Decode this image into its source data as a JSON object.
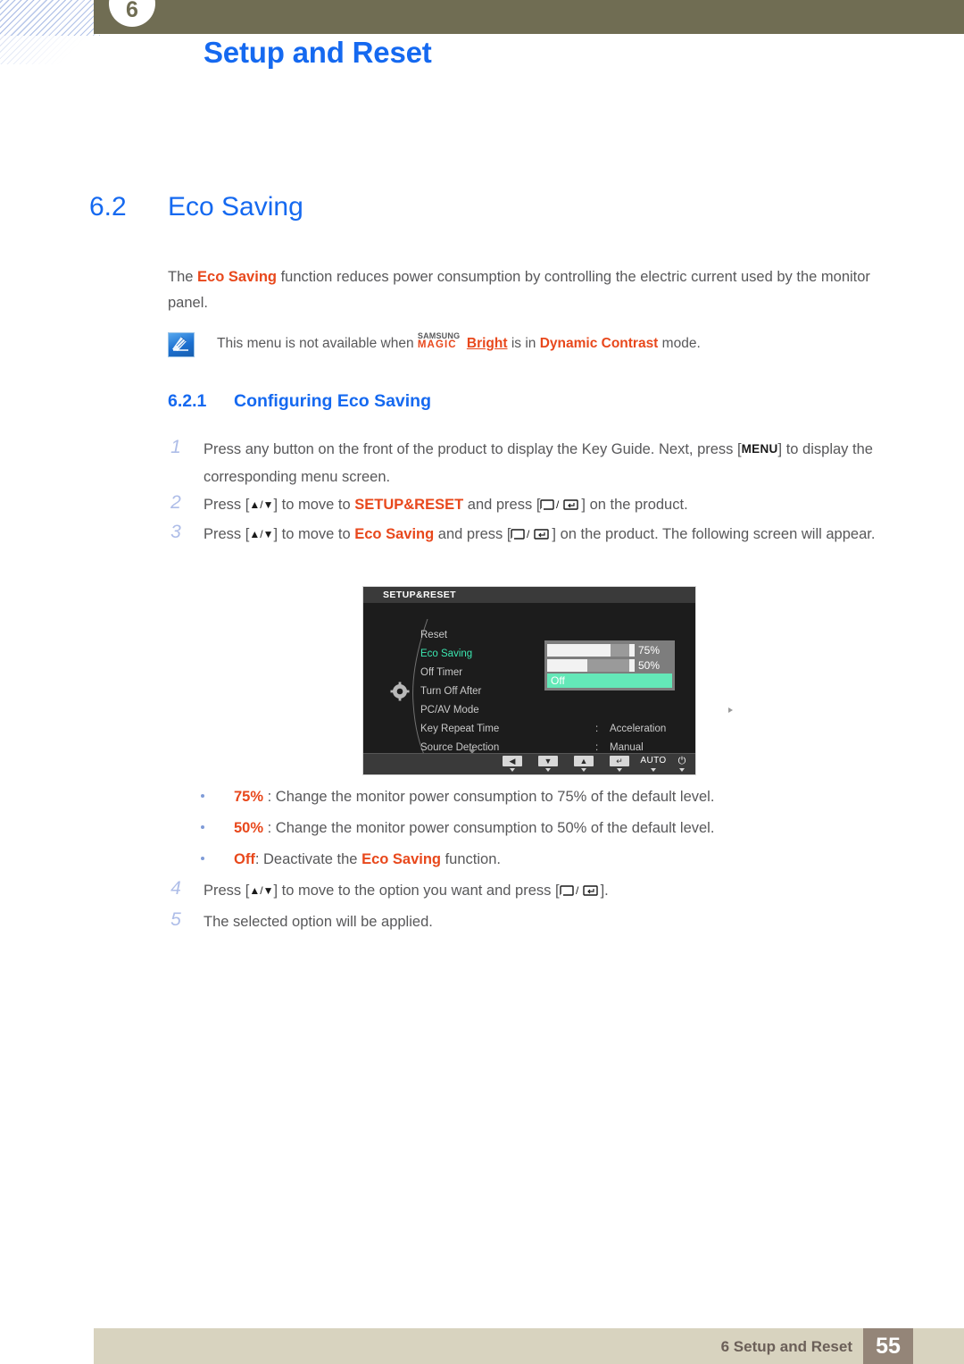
{
  "header": {
    "chapter_number": "6",
    "title": "Setup and Reset"
  },
  "section": {
    "number": "6.2",
    "title": "Eco Saving"
  },
  "intro": {
    "part1": "The ",
    "highlight": "Eco Saving",
    "part2": " function reduces power consumption by controlling the electric current used by the monitor panel."
  },
  "note": {
    "icon": "note-pencil-icon",
    "text_before": "This menu is not available when ",
    "magic_samsung": "SAMSUNG",
    "magic_word": "MAGIC",
    "magic_bright": "Bright",
    "text_middle": " is in ",
    "mode": "Dynamic Contrast",
    "text_after": " mode."
  },
  "subsection": {
    "number": "6.2.1",
    "title": "Configuring Eco Saving"
  },
  "steps": [
    {
      "num": "1",
      "text_a": "Press any button on the front of the product to display the Key Guide. Next, press [",
      "key": "MENU",
      "text_b": "] to display the corresponding menu screen."
    },
    {
      "num": "2",
      "text_a": "Press [",
      "arrows": "▲/▼",
      "text_b": "] to move to ",
      "target": "SETUP&RESET",
      "text_c": " and press [",
      "text_d": "] on the product."
    },
    {
      "num": "3",
      "text_a": "Press [",
      "arrows": "▲/▼",
      "text_b": "] to move to ",
      "target": "Eco Saving",
      "text_c": " and press [",
      "text_d": "] on the product. The following screen will appear."
    },
    {
      "num": "4",
      "text_a": "Press [",
      "arrows": "▲/▼",
      "text_b": "] to move to the option you want and press [",
      "text_d": "]."
    },
    {
      "num": "5",
      "text_a": "The selected option will be applied."
    }
  ],
  "osd": {
    "title": "SETUP&RESET",
    "gear_icon": "gear-icon",
    "rows": [
      {
        "label": "Reset",
        "colon": "",
        "value": "",
        "selected": false,
        "caret": false
      },
      {
        "label": "Eco Saving",
        "colon": ":",
        "value": "",
        "selected": true,
        "caret": false
      },
      {
        "label": "Off Timer",
        "colon": ":",
        "value": "",
        "selected": false,
        "caret": false
      },
      {
        "label": "Turn Off After",
        "colon": "",
        "value": "",
        "selected": false,
        "caret": false
      },
      {
        "label": "PC/AV Mode",
        "colon": "",
        "value": "",
        "selected": false,
        "caret": true
      },
      {
        "label": "Key Repeat Time",
        "colon": ":",
        "value": "Acceleration",
        "selected": false,
        "caret": false
      },
      {
        "label": "Source Detection",
        "colon": ":",
        "value": "Manual",
        "selected": false,
        "caret": false
      }
    ],
    "popup": {
      "options": [
        {
          "label": "75%",
          "fill_start_pct": 72,
          "fill_width_pct": 22
        },
        {
          "label": "50%",
          "fill_start_pct": 46,
          "fill_width_pct": 48
        }
      ],
      "off_label": "Off"
    },
    "footer_buttons": [
      {
        "name": "left-arrow-button",
        "glyph": "◀",
        "type": "glyph"
      },
      {
        "name": "down-arrow-button",
        "glyph": "▼",
        "type": "glyph"
      },
      {
        "name": "up-arrow-button",
        "glyph": "▲",
        "type": "glyph"
      },
      {
        "name": "enter-button",
        "glyph": "↵",
        "type": "glyph"
      },
      {
        "name": "auto-button",
        "glyph": "AUTO",
        "type": "text"
      },
      {
        "name": "power-button",
        "glyph": "⏻",
        "type": "power"
      }
    ]
  },
  "bullets": [
    {
      "term": "75%",
      "sep": " : ",
      "text": "Change the monitor power consumption to 75% of the default level."
    },
    {
      "term": "50%",
      "sep": " : ",
      "text": "Change the monitor power consumption to 50% of the default level."
    },
    {
      "term": "Off",
      "sep": ": ",
      "text_a": "Deactivate the ",
      "hl": "Eco Saving",
      "text_b": " function."
    }
  ],
  "footer": {
    "text": "6 Setup and Reset",
    "page": "55"
  },
  "colors": {
    "heading_blue": "#1569f0",
    "accent_orange": "#e8481c",
    "header_olive": "#706d53",
    "footer_beige": "#d8d3bf",
    "footer_page_box": "#948578",
    "osd_selected_green": "#3ce6b0",
    "body_gray": "#58585a",
    "step_number_blue": "#aebde8"
  }
}
